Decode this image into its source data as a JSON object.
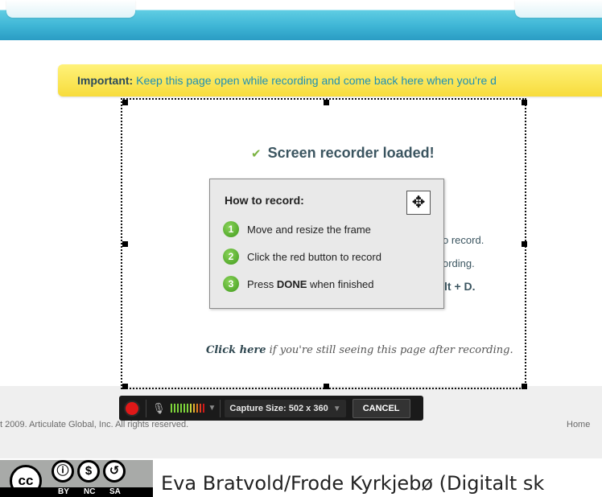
{
  "notice": {
    "label": "Important:",
    "message": "Keep this page open while recording and come back here when you're d"
  },
  "status": {
    "title": "Screen recorder loaded!"
  },
  "background_hints": {
    "line1": "o record.",
    "line2": "ording.",
    "line3": "lt + D."
  },
  "howto": {
    "title": "How to record:",
    "steps": [
      {
        "num": "1",
        "text": "Move and resize the frame"
      },
      {
        "num": "2",
        "text": "Click the red button to record"
      },
      {
        "num": "3",
        "pre": "Press ",
        "strong": "DONE",
        "post": " when finished"
      }
    ]
  },
  "click_here": {
    "link": "Click here",
    "rest": " if you're still seeing this page after recording."
  },
  "toolbar": {
    "capture_label": "Capture Size: 502 x 360",
    "cancel_label": "CANCEL",
    "meter_colors": [
      "#7dd43a",
      "#7dd43a",
      "#7dd43a",
      "#7dd43a",
      "#7dd43a",
      "#7dd43a",
      "#c8d43a",
      "#e6b030",
      "#e07a20",
      "#e03a20",
      "#d01818"
    ]
  },
  "footer": {
    "copyright": "t 2009. Articulate Global, Inc. All rights reserved.",
    "home": "Home"
  },
  "license": {
    "cc": "cc",
    "tags": [
      "BY",
      "NC",
      "SA"
    ],
    "attribution": "Eva Bratvold/Frode Kyrkjebø (Digitalt sk"
  },
  "colors": {
    "accent_blue": "#1e8fb5",
    "notice_yellow": "#f7dc3c",
    "record_red": "#e01818",
    "step_green": "#3f9a1c"
  }
}
